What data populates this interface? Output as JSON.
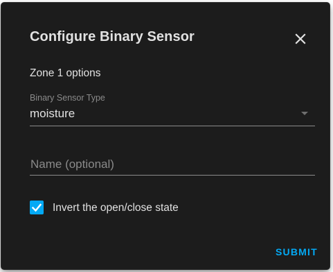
{
  "dialog": {
    "title": "Configure Binary Sensor",
    "close_icon": "close-icon"
  },
  "form": {
    "subtitle": "Zone 1 options",
    "sensor_type": {
      "label": "Binary Sensor Type",
      "value": "moisture",
      "icon": "dropdown-arrow-icon"
    },
    "name": {
      "placeholder": "Name (optional)",
      "value": ""
    },
    "invert": {
      "label": "Invert the open/close state",
      "checked": true,
      "icon": "checkmark-icon"
    }
  },
  "actions": {
    "submit_label": "SUBMIT"
  },
  "colors": {
    "background": "#1c1c1c",
    "text": "#e1e1e1",
    "secondary_text": "#8a8a8a",
    "accent": "#03a9f4"
  }
}
